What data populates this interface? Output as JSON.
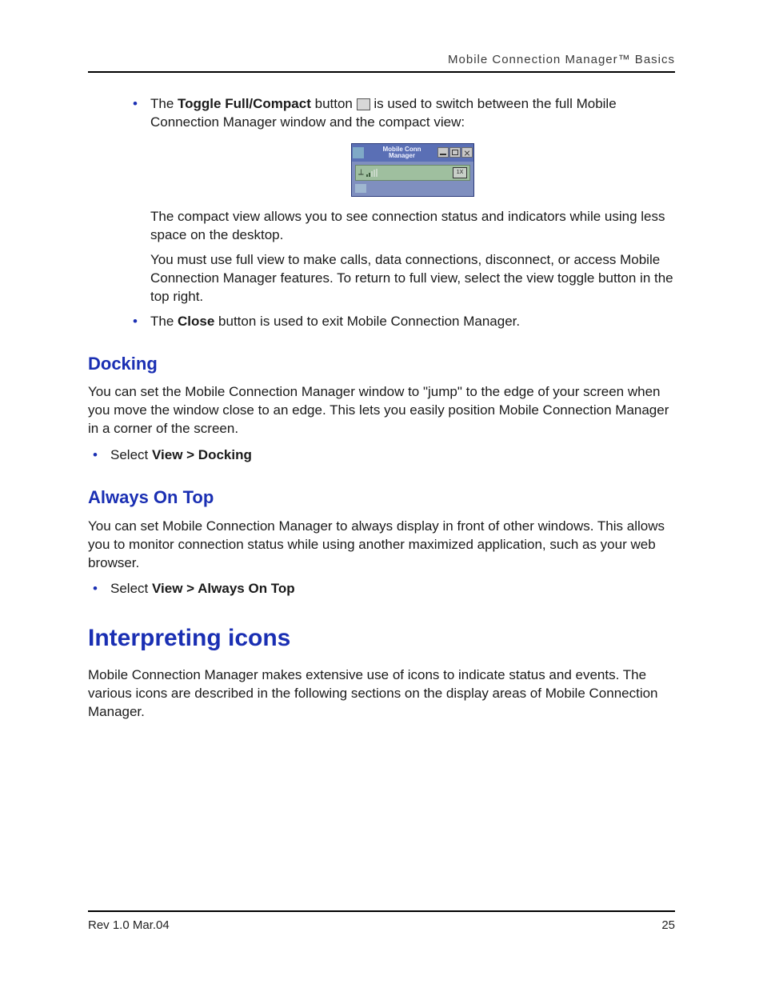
{
  "header": {
    "running_title": "Mobile Connection Manager™ Basics"
  },
  "body": {
    "bullet1_prefix": "The ",
    "bullet1_bold": "Toggle Full/Compact",
    "bullet1_mid": " button ",
    "bullet1_suffix": " is used to switch between the full Mobile Connection Manager window and the compact view:",
    "compact_desc": "The compact view allows you to see connection status and indicators while using less space on the desktop.",
    "fullview_note": "You must use full view to make calls, data connections, disconnect, or access Mobile Connection Manager features. To return to full view, select the view toggle button in the top right.",
    "bullet2_prefix": "The ",
    "bullet2_bold": "Close",
    "bullet2_suffix": " button is used to exit Mobile Connection Manager.",
    "docking_heading": "Docking",
    "docking_para": "You can set the Mobile Connection Manager window to \"jump\" to the edge of your screen when you move the window close to an edge. This lets you easily position Mobile Connection Manager in a corner of the screen.",
    "docking_bullet_prefix": "Select ",
    "docking_bullet_bold": "View > Docking",
    "ontop_heading": "Always On Top",
    "ontop_para": "You can set Mobile Connection Manager to always display in front of other windows. This allows you to monitor connection status while using another maximized application, such as your web browser.",
    "ontop_bullet_prefix": "Select ",
    "ontop_bullet_bold": "View > Always On Top",
    "icons_heading": "Interpreting icons",
    "icons_para": "Mobile Connection Manager makes extensive use of icons to indicate status and events. The various icons are described in the following sections on the display areas of Mobile Connection Manager."
  },
  "embedded_app": {
    "title_l1": "Mobile Conn",
    "title_l2": "Manager",
    "indicator": "1X"
  },
  "footer": {
    "rev": "Rev 1.0  Mar.04",
    "page": "25"
  }
}
